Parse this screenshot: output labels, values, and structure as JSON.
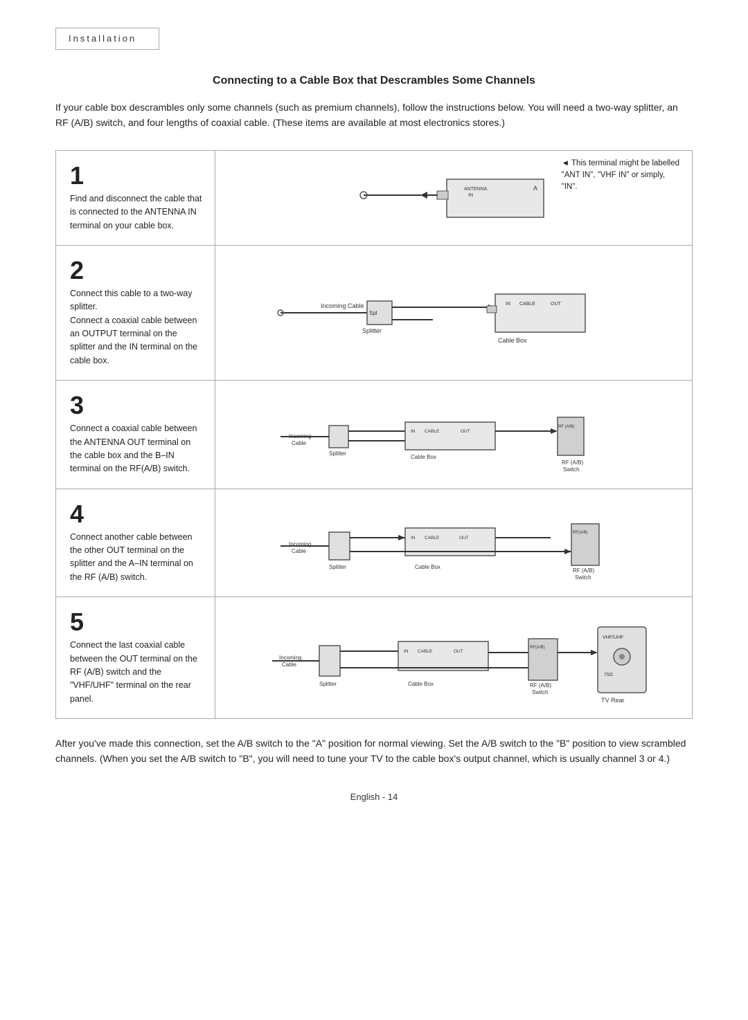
{
  "header": {
    "label": "Installation"
  },
  "section": {
    "title": "Connecting to a Cable Box that Descrambles Some Channels",
    "intro": "If your cable box descrambles only some channels (such as premium channels), follow the instructions below. You will need a two-way splitter, an RF (A/B) switch, and four lengths of coaxial cable. (These items are available at most electronics stores.)"
  },
  "note": {
    "triangle": "◄",
    "line1": "This terminal might be labelled",
    "line2": "\"ANT IN\", \"VHF IN\" or simply,",
    "line3": "\"IN\"."
  },
  "steps": [
    {
      "num": "1",
      "desc": "Find and disconnect the cable that is connected to the ANTENNA IN terminal on your cable box."
    },
    {
      "num": "2",
      "desc": "Connect this cable to a two-way splitter.\nConnect a coaxial cable between an OUTPUT terminal on the splitter and the IN terminal on the cable box."
    },
    {
      "num": "3",
      "desc": "Connect a coaxial cable between the ANTENNA OUT terminal on the cable box and the B–IN terminal on the RF(A/B) switch."
    },
    {
      "num": "4",
      "desc": "Connect another cable between the other OUT terminal on the splitter and the A–IN terminal on the RF (A/B) switch."
    },
    {
      "num": "5",
      "desc": "Connect the last coaxial cable between the OUT terminal on the RF (A/B) switch and the \"VHF/UHF\" terminal on the rear panel."
    }
  ],
  "outro": "After you've made this connection, set the A/B switch to the \"A\" position for normal viewing. Set the A/B switch to the \"B\" position to view scrambled channels. (When you set the A/B switch to \"B\", you will need to tune your TV to the cable box's output channel, which is usually channel 3 or 4.)",
  "page_number": "English - 14"
}
